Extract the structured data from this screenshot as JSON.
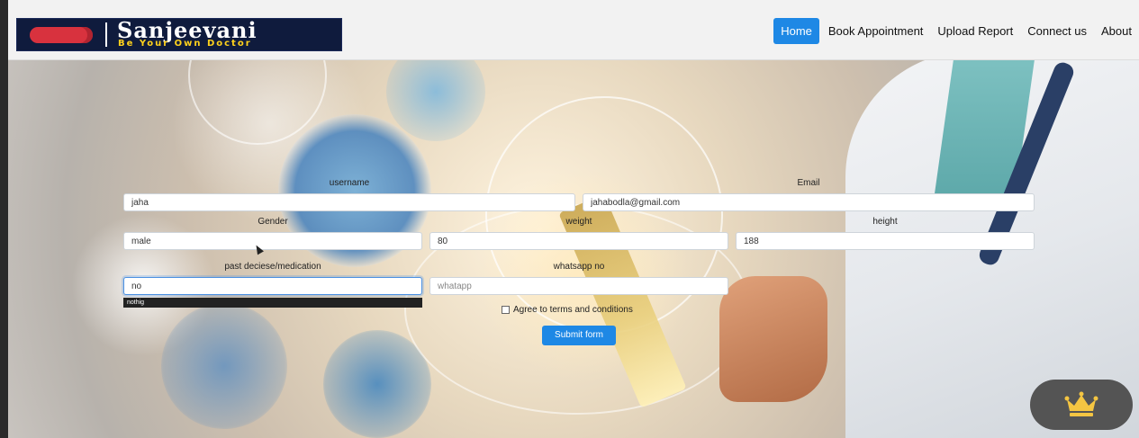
{
  "brand": {
    "name": "Sanjeevani",
    "tagline": "Be Your Own Doctor"
  },
  "nav": {
    "items": [
      "Home",
      "Book Appointment",
      "Upload Report",
      "Connect us",
      "About"
    ],
    "active": "Home"
  },
  "form": {
    "username_label": "username",
    "username_value": "jaha",
    "email_label": "Email",
    "email_value": "jahabodla@gmail.com",
    "gender_label": "Gender",
    "gender_value": "male",
    "weight_label": "weight",
    "weight_value": "80",
    "height_label": "height",
    "height_value": "188",
    "past_label": "past deciese/medication",
    "past_value": "no",
    "past_suggestion": "nothig",
    "whatsapp_label": "whatsapp no",
    "whatsapp_placeholder": "whatapp",
    "agree_label": "Agree to terms and conditions",
    "submit_label": "Submit form"
  },
  "colors": {
    "primary": "#1e88e5",
    "brand_bg": "#0f1b3d",
    "brand_accent": "#ffd21c",
    "crown": "#f4c542"
  },
  "icons": {
    "premium": "crown-icon"
  }
}
